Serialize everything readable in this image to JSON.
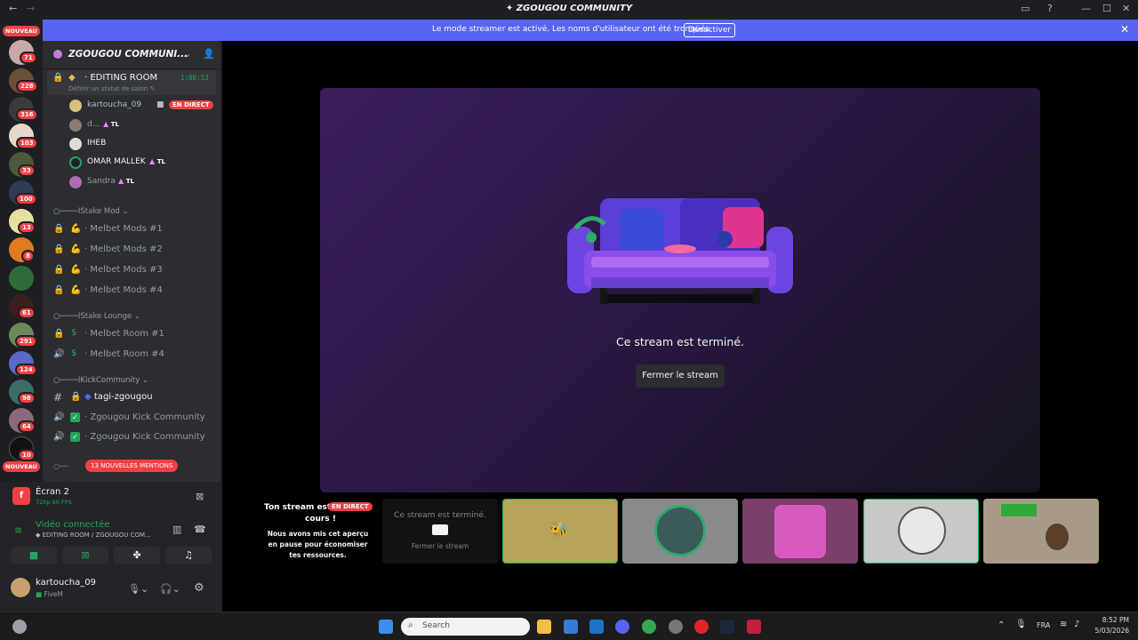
{
  "window": {
    "title": "ZGOUGOU COMMUNITY"
  },
  "banner": {
    "message": "Le mode streamer est activé. Les noms d'utilisateur ont été tronqués.",
    "button": "Désactiver"
  },
  "servers": {
    "new_top": "NOUVEAU",
    "new_bottom": "NOUVEAU",
    "badges": [
      "71",
      "228",
      "316",
      "103",
      "33",
      "100",
      "13",
      "8",
      "61",
      "291",
      "124",
      "98",
      "64",
      "10"
    ]
  },
  "server_header": {
    "name": "ZGOUGOU COMMUNI..."
  },
  "voice": {
    "channel": "EDITING ROOM",
    "timer": "1:06:53",
    "status_hint": "Définir un statut de salon",
    "live_tag": "EN DIRECT",
    "users": [
      {
        "name": "kartoucha_09",
        "tag": ""
      },
      {
        "name": "d...",
        "tag": "TL"
      },
      {
        "name": "IHEB",
        "tag": ""
      },
      {
        "name": "OMAR MALLEK",
        "tag": "TL"
      },
      {
        "name": "Sandra",
        "tag": "TL"
      }
    ]
  },
  "categories": [
    {
      "name": "IStake Mod",
      "channels": [
        "Melbet Mods #1",
        "Melbet Mods #2",
        "Melbet Mods #3",
        "Melbet Mods #4"
      ]
    },
    {
      "name": "IStake Lounge",
      "channels": [
        "Melbet Room #1",
        "Melbet Room #4"
      ]
    },
    {
      "name": "IKickCommunity",
      "channels": [
        "tagi-zgougou",
        "Zgougou Kick Community",
        "Zgougou Kick Community"
      ]
    }
  ],
  "mentions_pill": "13 NOUVELLES MENTIONS",
  "screen_share": {
    "title": "Écran 2",
    "quality": "720p 60 FPS"
  },
  "voice_status": {
    "title": "Vidéo connectée",
    "channel": "EDITING ROOM / ZGOUGOU COM..."
  },
  "user": {
    "name": "kartoucha_09",
    "status": "FiveM"
  },
  "stage": {
    "ended_text": "Ce stream est terminé.",
    "close_button": "Fermer le stream"
  },
  "tile": {
    "line1": "Ton stream est",
    "line2": "cours !",
    "live_tag": "EN DIRECT",
    "note": "Nous avons mis cet aperçu en pause pour économiser tes ressources."
  },
  "mini_preview": {
    "ended": "Ce stream est terminé.",
    "close": "Fermer le stream"
  },
  "taskbar": {
    "search_placeholder": "Search",
    "lang": "FRA",
    "time": "8:52 PM",
    "date": "5/03/2026"
  },
  "colors": {
    "accent": "#5865f2",
    "danger": "#f23f43",
    "sidebar": "#2b2d31",
    "green": "#23a55a"
  }
}
